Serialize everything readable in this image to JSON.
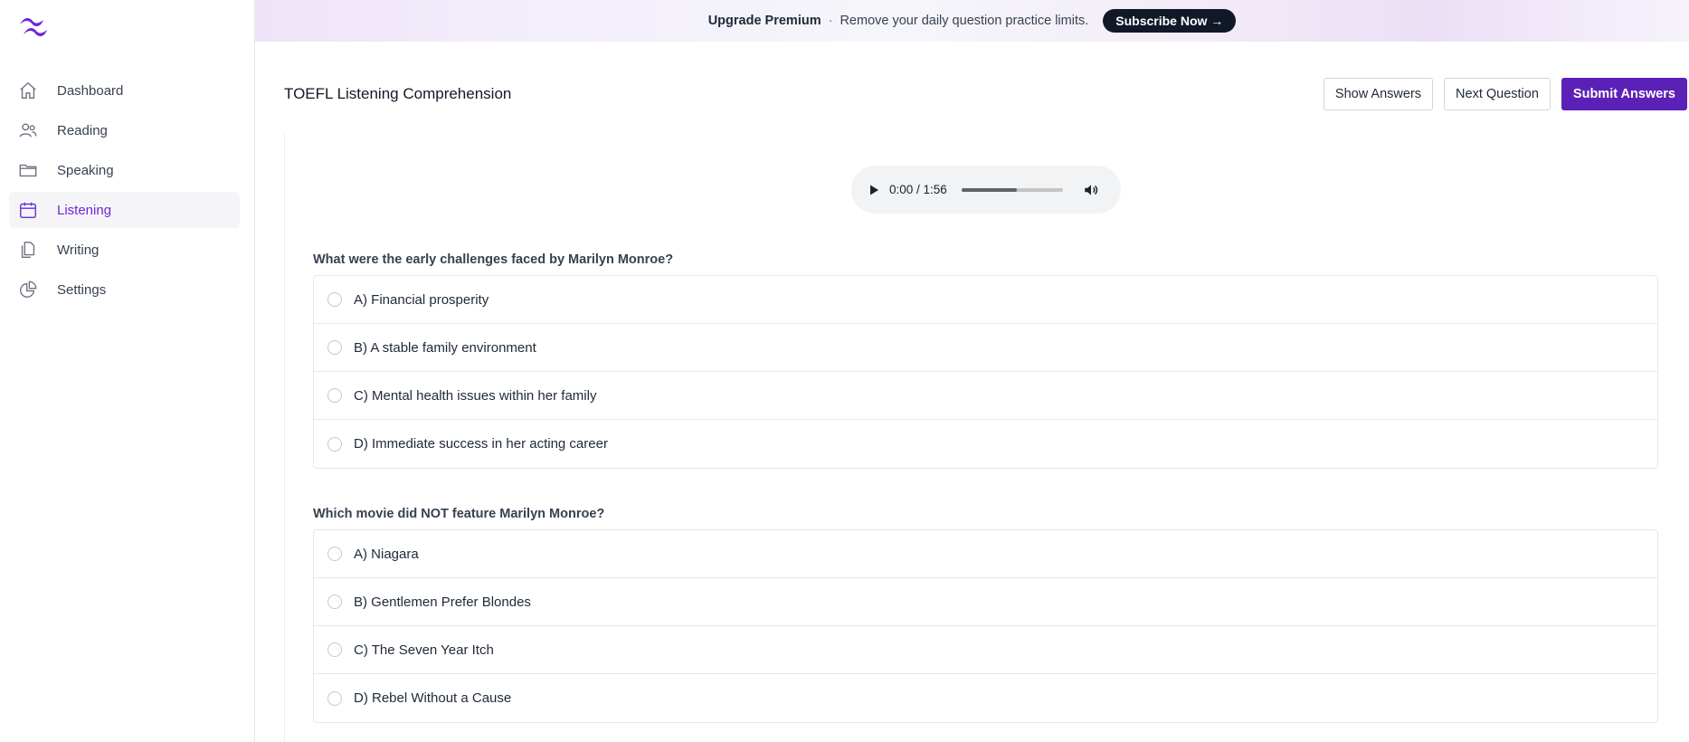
{
  "banner": {
    "title": "Upgrade Premium",
    "separator": "·",
    "message": "Remove your daily question practice limits.",
    "cta_label": "Subscribe Now →"
  },
  "sidebar": {
    "items": [
      {
        "label": "Dashboard",
        "icon": "home-icon",
        "active": false
      },
      {
        "label": "Reading",
        "icon": "users-icon",
        "active": false
      },
      {
        "label": "Speaking",
        "icon": "folder-icon",
        "active": false
      },
      {
        "label": "Listening",
        "icon": "calendar-icon",
        "active": true
      },
      {
        "label": "Writing",
        "icon": "documents-icon",
        "active": false
      },
      {
        "label": "Settings",
        "icon": "pie-chart-icon",
        "active": false
      }
    ]
  },
  "header": {
    "title": "TOEFL Listening Comprehension",
    "show_answers_label": "Show Answers",
    "next_question_label": "Next Question",
    "submit_label": "Submit Answers"
  },
  "audio": {
    "time": "0:00 / 1:56",
    "volume_level": 0.55
  },
  "questions": [
    {
      "text": "What were the early challenges faced by Marilyn Monroe?",
      "options": [
        "A) Financial prosperity",
        "B) A stable family environment",
        "C) Mental health issues within her family",
        "D) Immediate success in her acting career"
      ]
    },
    {
      "text": "Which movie did NOT feature Marilyn Monroe?",
      "options": [
        "A) Niagara",
        "B) Gentlemen Prefer Blondes",
        "C) The Seven Year Itch",
        "D) Rebel Without a Cause"
      ]
    }
  ],
  "colors": {
    "accent": "#6d28d9",
    "primary_button": "#5b21b6",
    "cta_background": "#111827"
  }
}
